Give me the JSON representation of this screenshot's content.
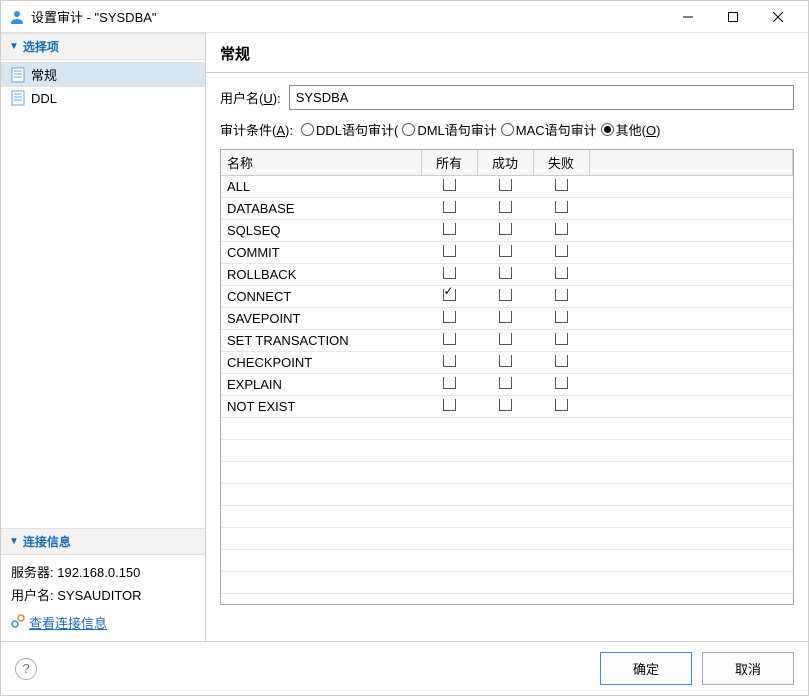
{
  "window": {
    "title": "设置审计 - \"SYSDBA\""
  },
  "sidebar": {
    "section_options": "选择项",
    "items": [
      {
        "label": "常规",
        "selected": true
      },
      {
        "label": "DDL",
        "selected": false
      }
    ],
    "section_conn": "连接信息",
    "server_label": "服务器:",
    "server_value": "192.168.0.150",
    "user_label": "用户名:",
    "user_value": "SYSAUDITOR",
    "view_conn_link": "查看连接信息"
  },
  "main": {
    "header": "常规",
    "username_label_pre": "用户名(",
    "username_label_u": "U",
    "username_label_post": "):",
    "username_value": "SYSDBA",
    "condition_label_pre": "审计条件(",
    "condition_label_u": "A",
    "condition_label_post": "):",
    "radios": [
      {
        "label": "DDL语句审计(",
        "checked": false
      },
      {
        "label": "DML语句审计",
        "checked": false
      },
      {
        "label": "MAC语句审计",
        "checked": false
      },
      {
        "label_pre": "其他(",
        "label_u": "O",
        "label_post": ")",
        "checked": true
      }
    ],
    "table": {
      "columns": [
        "名称",
        "所有",
        "成功",
        "失败"
      ],
      "rows": [
        {
          "name": "ALL",
          "all": false,
          "success": false,
          "fail": false
        },
        {
          "name": "DATABASE",
          "all": false,
          "success": false,
          "fail": false
        },
        {
          "name": "SQLSEQ",
          "all": false,
          "success": false,
          "fail": false
        },
        {
          "name": "COMMIT",
          "all": false,
          "success": false,
          "fail": false
        },
        {
          "name": "ROLLBACK",
          "all": false,
          "success": false,
          "fail": false
        },
        {
          "name": "CONNECT",
          "all": true,
          "success": false,
          "fail": false
        },
        {
          "name": "SAVEPOINT",
          "all": false,
          "success": false,
          "fail": false
        },
        {
          "name": "SET TRANSACTION",
          "all": false,
          "success": false,
          "fail": false
        },
        {
          "name": "CHECKPOINT",
          "all": false,
          "success": false,
          "fail": false
        },
        {
          "name": "EXPLAIN",
          "all": false,
          "success": false,
          "fail": false
        },
        {
          "name": "NOT EXIST",
          "all": false,
          "success": false,
          "fail": false
        }
      ],
      "empty_rows": 8
    }
  },
  "footer": {
    "ok": "确定",
    "cancel": "取消"
  }
}
